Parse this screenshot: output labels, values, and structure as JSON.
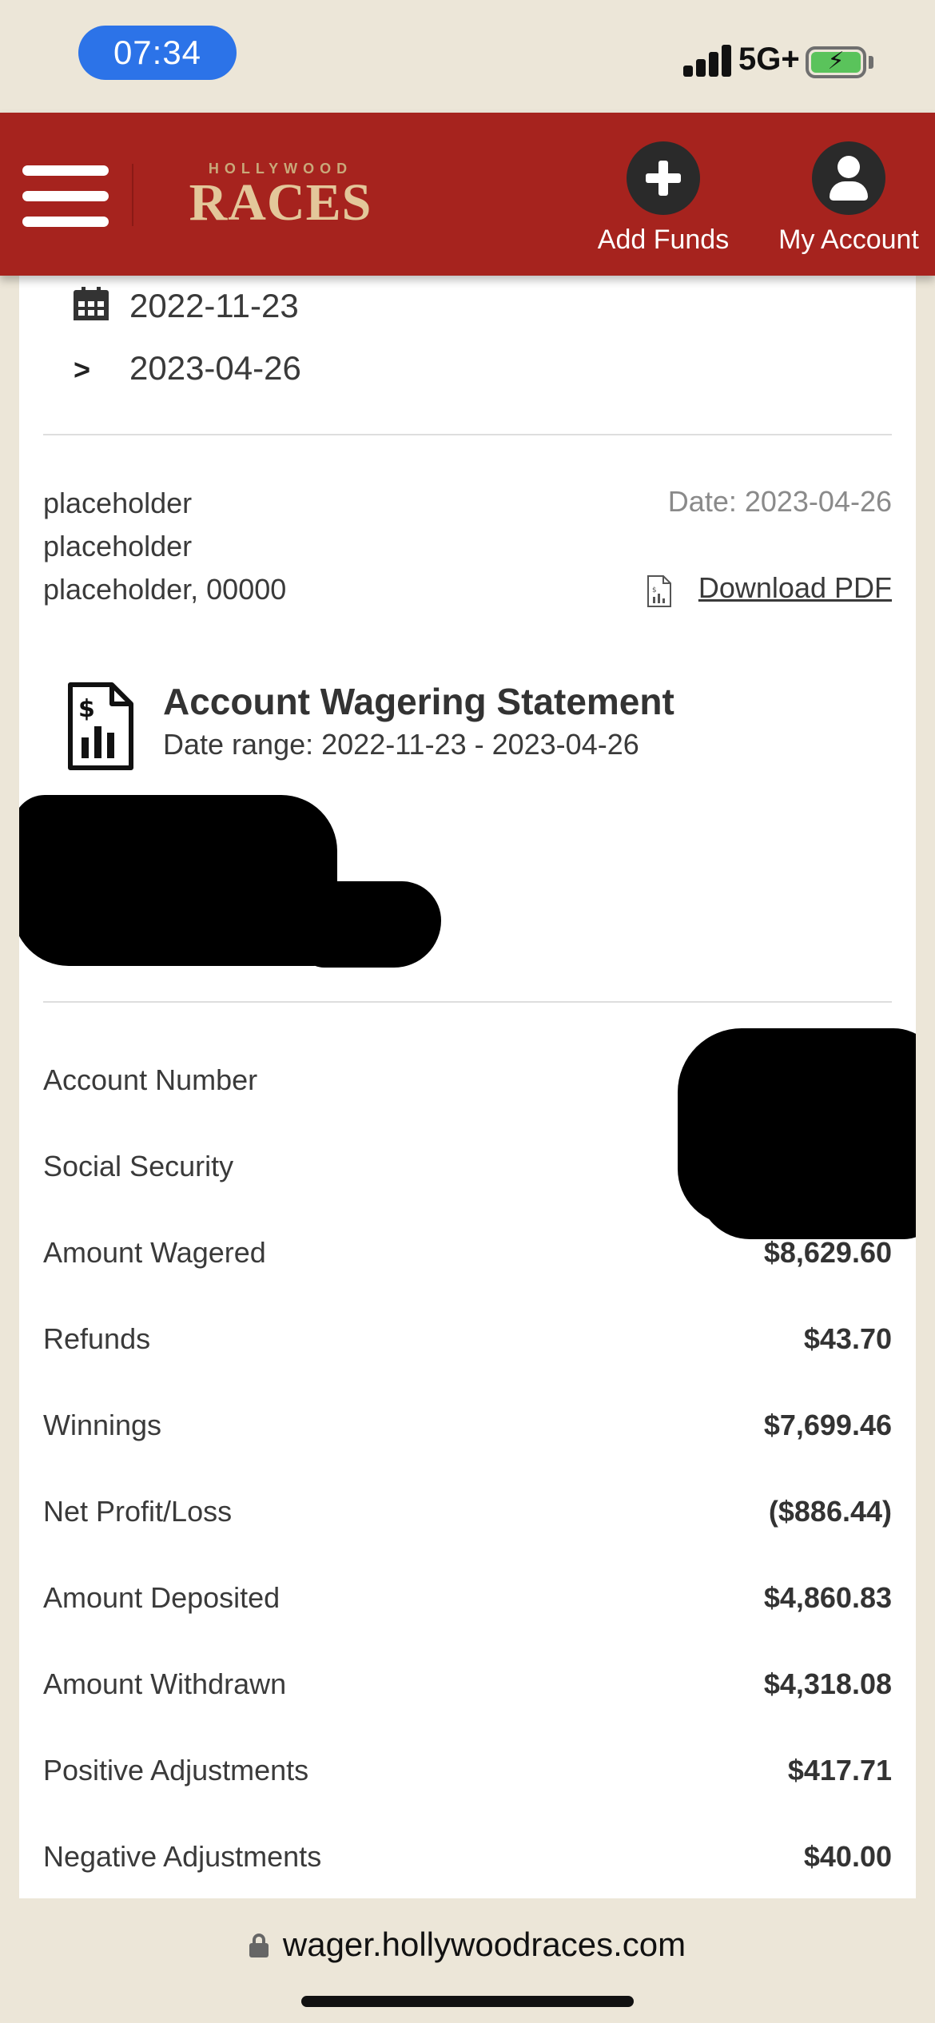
{
  "status_bar": {
    "time": "07:34",
    "network": "5G+"
  },
  "header": {
    "logo_top": "HOLLYWOOD",
    "logo_main": "RACES",
    "add_funds_label": "Add Funds",
    "my_account_label": "My Account"
  },
  "date_filter": {
    "start": "2022-11-23",
    "end_prefix": ">",
    "end": "2023-04-26"
  },
  "address": {
    "line1": "placeholder",
    "line2": "placeholder",
    "line3": "placeholder, 00000"
  },
  "statement": {
    "date": "Date: 2023-04-26",
    "download_label": "Download PDF",
    "title": "Account Wagering Statement",
    "range": "Date range: 2022-11-23 - 2023-04-26"
  },
  "summary": {
    "rows": [
      {
        "label": "Account Number",
        "value": ""
      },
      {
        "label": "Social Security",
        "value": ""
      },
      {
        "label": "Amount Wagered",
        "value": "$8,629.60"
      },
      {
        "label": "Refunds",
        "value": "$43.70"
      },
      {
        "label": "Winnings",
        "value": "$7,699.46"
      },
      {
        "label": "Net Profit/Loss",
        "value": "($886.44)"
      },
      {
        "label": "Amount Deposited",
        "value": "$4,860.83"
      },
      {
        "label": "Amount Withdrawn",
        "value": "$4,318.08"
      },
      {
        "label": "Positive Adjustments",
        "value": "$417.71"
      },
      {
        "label": "Negative Adjustments",
        "value": "$40.00"
      }
    ]
  },
  "browser": {
    "url": "wager.hollywoodraces.com"
  },
  "colors": {
    "header_red": "#a6231e",
    "logo_gold": "#e3c79a",
    "time_pill": "#2c73e8",
    "battery": "#5ac35b"
  }
}
